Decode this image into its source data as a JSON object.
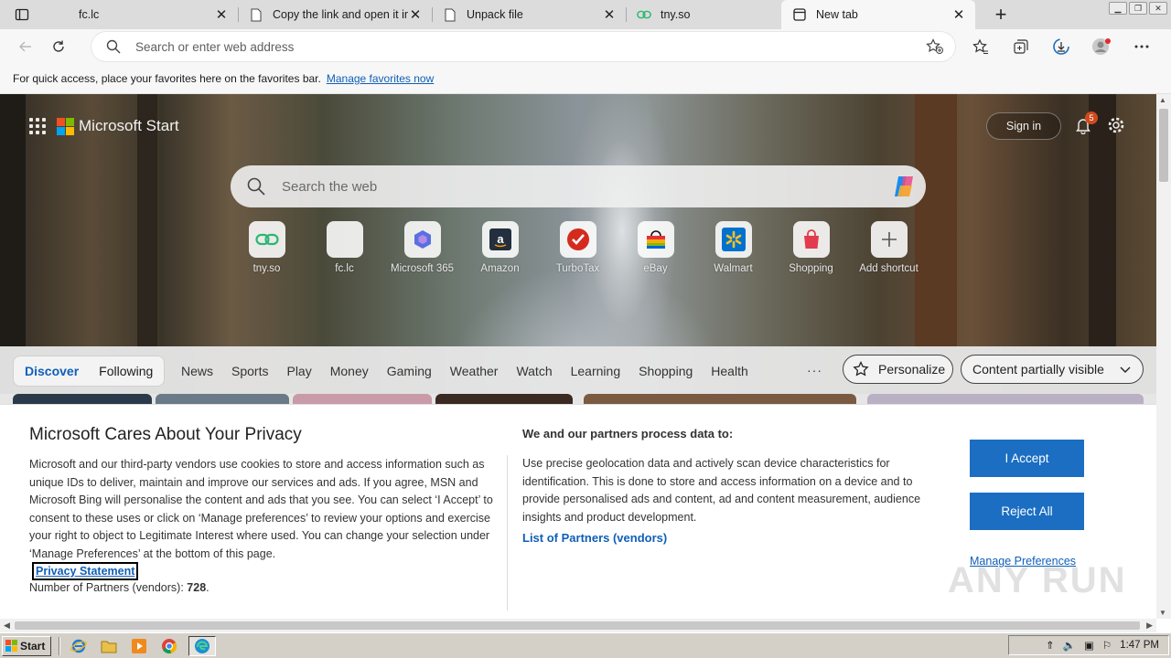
{
  "tabs": [
    {
      "title": "fc.lc",
      "icon": "page-icon",
      "close": "✕"
    },
    {
      "title": "Copy the link and open it in",
      "icon": "page-icon",
      "close": "✕"
    },
    {
      "title": "Unpack file",
      "icon": "page-icon",
      "close": "✕"
    },
    {
      "title": "tny.so",
      "icon": "link-icon",
      "close": ""
    },
    {
      "title": "New tab",
      "icon": "newtab-icon",
      "close": "✕"
    }
  ],
  "new_tab_button": "+",
  "address_bar": {
    "placeholder": "Search or enter web address",
    "value": ""
  },
  "favorites_bar": {
    "message": "For quick access, place your favorites here on the favorites bar.",
    "link": "Manage favorites now"
  },
  "start_page": {
    "brand": "Microsoft Start",
    "sign_in": "Sign in",
    "notifications_count": "5",
    "search_placeholder": "Search the web",
    "shortcuts": [
      {
        "label": "tny.so",
        "icon": "link-icon"
      },
      {
        "label": "fc.lc",
        "icon": "blank-icon"
      },
      {
        "label": "Microsoft 365",
        "icon": "m365-icon"
      },
      {
        "label": "Amazon",
        "icon": "amazon-icon"
      },
      {
        "label": "TurboTax",
        "icon": "turbotax-icon"
      },
      {
        "label": "eBay",
        "icon": "ebay-icon"
      },
      {
        "label": "Walmart",
        "icon": "walmart-icon"
      },
      {
        "label": "Shopping",
        "icon": "shopping-icon"
      },
      {
        "label": "Add shortcut",
        "icon": "plus-icon"
      }
    ],
    "feed_tabs": [
      "Discover",
      "Following"
    ],
    "categories": [
      "News",
      "Sports",
      "Play",
      "Money",
      "Gaming",
      "Weather",
      "Watch",
      "Learning",
      "Shopping",
      "Health"
    ],
    "more": "···",
    "personalize": "Personalize",
    "content_visibility": "Content partially visible"
  },
  "consent": {
    "title": "Microsoft Cares About Your Privacy",
    "body": "Microsoft and our third-party vendors use cookies to store and access information such as unique IDs to deliver, maintain and improve our services and ads. If you agree, MSN and Microsoft Bing will personalise the content and ads that you see. You can select ‘I Accept’ to consent to these uses or click on ‘Manage preferences’ to review your options and exercise your right to object to Legitimate Interest where used.  You can change your selection under ‘Manage Preferences’ at the bottom of this page.",
    "privacy_link": "Privacy Statement",
    "partners_label": "Number of Partners (vendors):",
    "partners_count": "728",
    "partners_suffix": ".",
    "right_heading": "We and our partners process data to:",
    "right_body": "Use precise geolocation data and actively scan device characteristics for identification. This is done to store and access information on a device and to provide personalised ads and content, ad and content measurement, audience insights and product development.",
    "vendors_link": "List of Partners (vendors)",
    "accept": "I Accept",
    "reject": "Reject All",
    "manage": "Manage Preferences"
  },
  "watermark": "ANY RUN",
  "taskbar": {
    "start": "Start",
    "clock": "1:47 PM"
  },
  "colors": {
    "accent": "#1b6ec2",
    "link": "#0f5fb8",
    "badge": "#d04a1e"
  }
}
